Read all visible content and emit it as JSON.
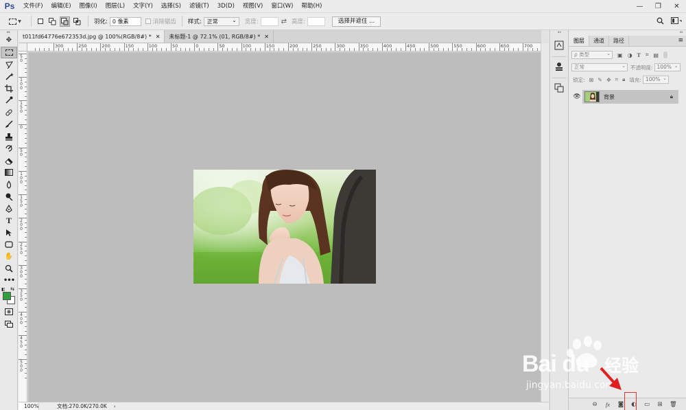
{
  "app": {
    "logo": "Ps"
  },
  "menu": [
    "文件(F)",
    "编辑(E)",
    "图像(I)",
    "图层(L)",
    "文字(Y)",
    "选择(S)",
    "滤镜(T)",
    "3D(D)",
    "视图(V)",
    "窗口(W)",
    "帮助(H)"
  ],
  "window_controls": {
    "minimize": "—",
    "restore": "❐",
    "close": "✕"
  },
  "options": {
    "feather_label": "羽化:",
    "feather_value": "0 像素",
    "antialias_label": "消除锯齿",
    "style_label": "样式:",
    "style_value": "正常",
    "width_label": "宽度:",
    "height_label": "高度:",
    "select_mask_button": "选择并遮住 ..."
  },
  "tabs": [
    {
      "label": "t011fd64776e672353d.jpg @ 100%(RGB/8#) *",
      "close": "✕",
      "active": true
    },
    {
      "label": "未标题-1 @ 72.1% (01, RGB/8#) *",
      "close": "✕",
      "active": false
    }
  ],
  "ruler_h_labels": [
    "300",
    "250",
    "200",
    "150",
    "100",
    "50",
    "0",
    "50",
    "100",
    "150",
    "200",
    "250",
    "300",
    "350",
    "400",
    "450",
    "500",
    "550",
    "600",
    "650",
    "700"
  ],
  "ruler_v_labels": [
    "5 0",
    "1 0 0",
    "1 5 0",
    "0",
    "5 0",
    "1 0 0",
    "1 5 0",
    "2 0 0",
    "2 5 0",
    "3 0 0",
    "3 5 0",
    "4 0 0",
    "4 5 0",
    "5 0 0"
  ],
  "status": {
    "zoom": "100%",
    "doc": "文档:270.0K/270.0K",
    "arrow": "›"
  },
  "layers_panel": {
    "tabs": [
      "图层",
      "通道",
      "路径"
    ],
    "filter_kind": "ρ 类型",
    "blend_mode": "正常",
    "opacity_label": "不透明度:",
    "opacity_value": "100%",
    "lock_label": "锁定:",
    "fill_label": "填充:",
    "fill_value": "100%",
    "layers": [
      {
        "name": "背景",
        "locked": true,
        "visible": true
      }
    ],
    "bottom_icons": [
      "link-icon",
      "fx-icon",
      "mask-icon",
      "adjustment-icon",
      "folder-icon",
      "new-layer-icon",
      "trash-icon"
    ],
    "fx_label": "fx"
  },
  "watermark": {
    "brand": "Bai",
    "brand2": "du",
    "cn": "经验",
    "url": "jingyan.baidu.com"
  },
  "colors": {
    "foreground": "#2fa03a",
    "background": "#ffffff",
    "canvas": "#bdbdbd",
    "highlight": "#e53131"
  }
}
